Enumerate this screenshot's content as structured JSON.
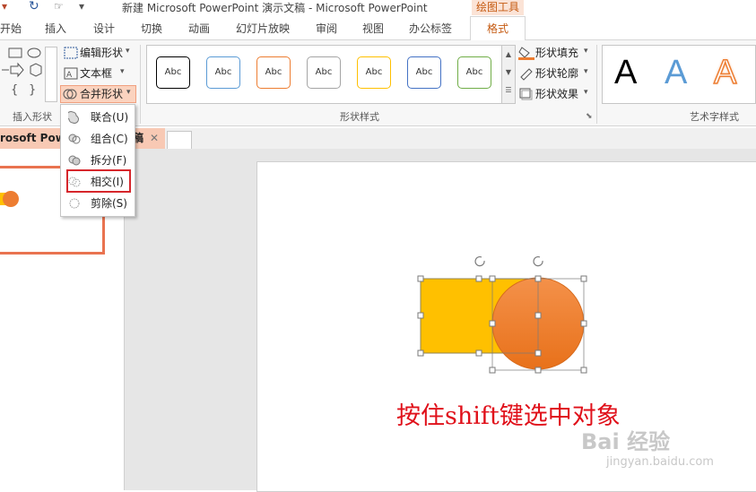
{
  "title_bar": {
    "title": "新建 Microsoft PowerPoint 演示文稿 - Microsoft PowerPoint",
    "context_tab": "绘图工具"
  },
  "ribbon_tabs": [
    "开始",
    "插入",
    "设计",
    "切换",
    "动画",
    "幻灯片放映",
    "审阅",
    "视图",
    "办公标签"
  ],
  "active_tab": "格式",
  "insert_shapes": {
    "group_label": "插入形状",
    "edit_shape": "编辑形状",
    "text_box": "文本框",
    "merge_shapes": "合并形状"
  },
  "shape_styles": {
    "group_label": "形状样式",
    "style_sample_text": "Abc",
    "style_colors": [
      "#000000",
      "#5b9bd5",
      "#ed7d31",
      "#a5a5a5",
      "#ffc000",
      "#4472c4",
      "#70ad47"
    ],
    "fill": "形状填充",
    "outline": "形状轮廓",
    "effects": "形状效果"
  },
  "wordart": {
    "group_label": "艺术字样式",
    "samples": [
      "A",
      "A",
      "A"
    ],
    "sample_colors": [
      "#000000",
      "#5b9bd5",
      "#ed7d31"
    ]
  },
  "merge_menu": {
    "items": [
      {
        "label": "联合(U)",
        "icon": "union-icon"
      },
      {
        "label": "组合(C)",
        "icon": "combine-icon"
      },
      {
        "label": "拆分(F)",
        "icon": "fragment-icon"
      },
      {
        "label": "相交(I)",
        "icon": "intersect-icon"
      },
      {
        "label": "剪除(S)",
        "icon": "subtract-icon"
      }
    ],
    "highlighted_index": 3
  },
  "document_tab": {
    "label": "rosoft Powe",
    "label_right": "稿"
  },
  "slide": {
    "caption": "按住shift键选中对象",
    "rectangle_color": "#ffc000",
    "circle_color": "#ed7d31"
  },
  "watermark": {
    "brand": "Bai 经验",
    "url": "jingyan.baidu.com"
  }
}
